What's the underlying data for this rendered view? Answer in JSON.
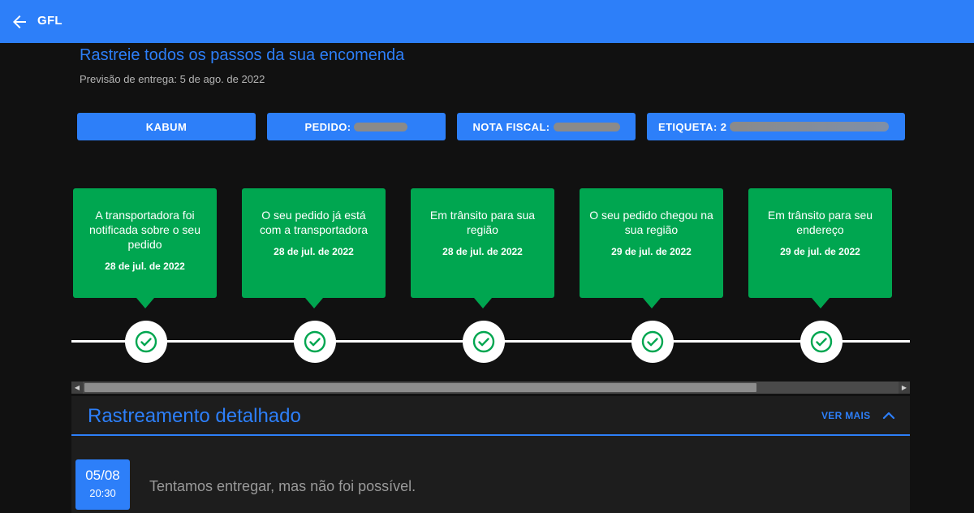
{
  "appbar": {
    "title": "GFL",
    "back_icon": "arrow-left-icon"
  },
  "header": {
    "headline": "Rastreie todos os passos da sua encomenda",
    "delivery_estimate": "Previsão de entrega: 5 de ago. de 2022"
  },
  "chips": [
    {
      "label": "KABUM"
    },
    {
      "label": "PEDIDO: ",
      "redacted": true
    },
    {
      "label": "NOTA FISCAL: ",
      "redacted": true
    },
    {
      "label": "ETIQUETA: 2",
      "redacted": true
    }
  ],
  "steps": [
    {
      "title": "A transportadora foi notificada sobre o seu pedido",
      "date": "28 de jul. de 2022"
    },
    {
      "title": "O seu pedido já está com a transportadora",
      "date": "28 de jul. de 2022"
    },
    {
      "title": "Em trânsito para sua região",
      "date": "28 de jul. de 2022"
    },
    {
      "title": "O seu pedido chegou na sua região",
      "date": "29 de jul. de 2022"
    },
    {
      "title": "Em trânsito para seu endereço",
      "date": "29 de jul. de 2022"
    }
  ],
  "detail": {
    "title": "Rastreamento detalhado",
    "ver_mais": "VER MAIS",
    "events": [
      {
        "day": "05/08",
        "time": "20:30",
        "text": "Tentamos entregar, mas não foi possível."
      }
    ]
  },
  "colors": {
    "primary": "#2d7ff9",
    "success": "#00a650",
    "background": "#111111"
  }
}
